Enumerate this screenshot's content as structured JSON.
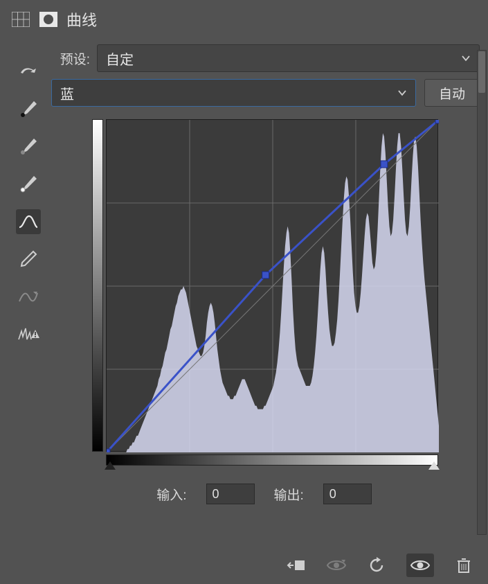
{
  "header": {
    "title": "曲线"
  },
  "preset": {
    "label": "预设:",
    "value": "自定"
  },
  "channel": {
    "value": "蓝"
  },
  "auto_label": "自动",
  "io": {
    "input_label": "输入:",
    "input_value": "0",
    "output_label": "输出:",
    "output_value": "0"
  },
  "colors": {
    "curve": "#3a52c8",
    "histogram": "#d7d9f2"
  },
  "chart_data": {
    "type": "line",
    "curve_points": [
      {
        "x": 0,
        "y": 0
      },
      {
        "x": 122,
        "y": 136
      },
      {
        "x": 213,
        "y": 221
      },
      {
        "x": 255,
        "y": 255
      }
    ],
    "baseline": [
      {
        "x": 0,
        "y": 0
      },
      {
        "x": 255,
        "y": 255
      }
    ],
    "histogram_channel": "blue",
    "histogram_x_range": [
      0,
      255
    ],
    "histogram_y_range_normalized": [
      0,
      1
    ],
    "histogram": [
      0.0,
      0.0,
      0.0,
      0.0,
      0.0,
      0.0,
      0.0,
      0.0,
      0.0,
      0.0,
      0.0,
      0.0,
      0.0,
      0.0,
      0.0,
      0.0,
      0.01,
      0.01,
      0.02,
      0.02,
      0.03,
      0.03,
      0.04,
      0.05,
      0.05,
      0.06,
      0.07,
      0.08,
      0.09,
      0.1,
      0.11,
      0.12,
      0.13,
      0.14,
      0.15,
      0.16,
      0.17,
      0.18,
      0.19,
      0.2,
      0.22,
      0.23,
      0.25,
      0.26,
      0.28,
      0.3,
      0.31,
      0.33,
      0.35,
      0.37,
      0.38,
      0.4,
      0.42,
      0.44,
      0.45,
      0.47,
      0.48,
      0.49,
      0.49,
      0.5,
      0.49,
      0.48,
      0.46,
      0.44,
      0.42,
      0.4,
      0.38,
      0.36,
      0.34,
      0.32,
      0.31,
      0.3,
      0.29,
      0.29,
      0.3,
      0.32,
      0.35,
      0.39,
      0.42,
      0.44,
      0.45,
      0.44,
      0.42,
      0.39,
      0.35,
      0.31,
      0.28,
      0.25,
      0.23,
      0.21,
      0.2,
      0.19,
      0.18,
      0.17,
      0.17,
      0.16,
      0.16,
      0.16,
      0.17,
      0.17,
      0.18,
      0.19,
      0.2,
      0.21,
      0.22,
      0.22,
      0.22,
      0.21,
      0.2,
      0.19,
      0.18,
      0.17,
      0.16,
      0.15,
      0.14,
      0.14,
      0.13,
      0.13,
      0.13,
      0.13,
      0.13,
      0.14,
      0.14,
      0.15,
      0.16,
      0.17,
      0.18,
      0.19,
      0.2,
      0.22,
      0.24,
      0.27,
      0.31,
      0.36,
      0.42,
      0.49,
      0.56,
      0.62,
      0.66,
      0.68,
      0.66,
      0.6,
      0.52,
      0.43,
      0.36,
      0.31,
      0.28,
      0.26,
      0.25,
      0.24,
      0.23,
      0.22,
      0.21,
      0.2,
      0.2,
      0.2,
      0.2,
      0.21,
      0.23,
      0.26,
      0.3,
      0.35,
      0.41,
      0.48,
      0.55,
      0.6,
      0.62,
      0.6,
      0.55,
      0.48,
      0.42,
      0.37,
      0.34,
      0.32,
      0.32,
      0.33,
      0.36,
      0.4,
      0.46,
      0.53,
      0.61,
      0.69,
      0.76,
      0.81,
      0.83,
      0.82,
      0.77,
      0.7,
      0.62,
      0.54,
      0.48,
      0.44,
      0.42,
      0.42,
      0.44,
      0.48,
      0.53,
      0.59,
      0.65,
      0.7,
      0.72,
      0.71,
      0.67,
      0.62,
      0.57,
      0.55,
      0.56,
      0.6,
      0.67,
      0.76,
      0.85,
      0.92,
      0.96,
      0.95,
      0.9,
      0.82,
      0.74,
      0.68,
      0.65,
      0.66,
      0.7,
      0.77,
      0.85,
      0.92,
      0.96,
      0.96,
      0.92,
      0.85,
      0.77,
      0.7,
      0.66,
      0.65,
      0.68,
      0.74,
      0.82,
      0.89,
      0.94,
      0.95,
      0.92,
      0.86,
      0.78,
      0.7,
      0.63,
      0.57,
      0.52,
      0.48,
      0.44,
      0.4,
      0.36,
      0.32,
      0.28,
      0.24,
      0.2,
      0.16,
      0.12,
      0.08
    ],
    "xlabel": "",
    "ylabel": "",
    "xlim": [
      0,
      255
    ],
    "ylim": [
      0,
      255
    ]
  }
}
